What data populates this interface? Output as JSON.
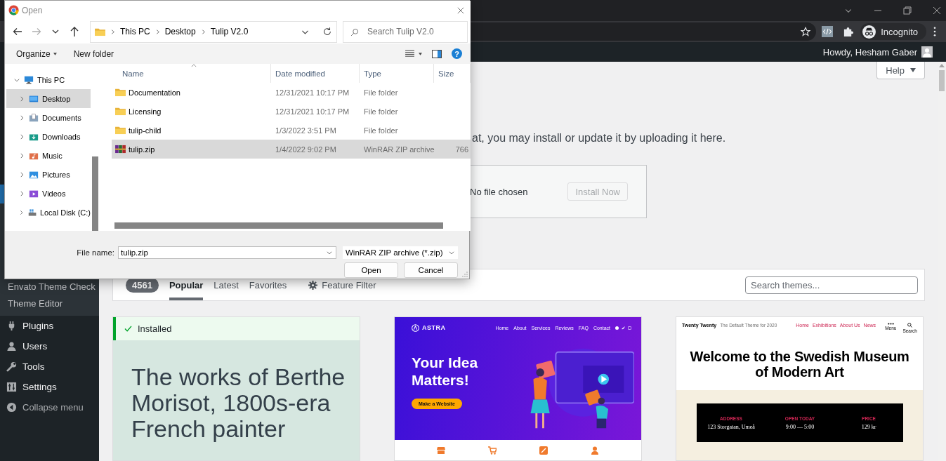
{
  "browser": {
    "profile_label": "Incognito"
  },
  "admin_bar": {
    "greeting": "Howdy, Hesham Gaber"
  },
  "sidebar": {
    "submenu": [
      {
        "label": "Envato Theme Check"
      },
      {
        "label": "Theme Editor"
      }
    ],
    "menu": [
      {
        "label": "Plugins"
      },
      {
        "label": "Users"
      },
      {
        "label": "Tools"
      },
      {
        "label": "Settings"
      },
      {
        "label": "Collapse menu"
      }
    ]
  },
  "help_button": {
    "label": "Help"
  },
  "upload": {
    "intro": "at, you may install or update it by uploading it here.",
    "file_status": "No file chosen",
    "install_button": {
      "label": "Install Now",
      "disabled": true
    }
  },
  "themes_bar": {
    "count": "4561",
    "tabs": [
      {
        "label": "Popular",
        "selected": true
      },
      {
        "label": "Latest",
        "selected": false
      },
      {
        "label": "Favorites",
        "selected": false
      }
    ],
    "feature_filter": "Feature Filter",
    "search": {
      "placeholder": "Search themes..."
    }
  },
  "theme_cards": [
    {
      "kind": "installed",
      "status": "Installed",
      "preview_text": "The works of Berthe Morisot, 1800s-era French painter"
    },
    {
      "kind": "astra",
      "logo": "ASTRA",
      "nav": [
        "Home",
        "About",
        "Services",
        "Reviews",
        "FAQ",
        "Contact"
      ],
      "headline": "Your Idea Matters!",
      "cta": "Make a Website"
    },
    {
      "kind": "twentytwenty",
      "site_title": "Twenty Twenty",
      "tagline": "The Default Theme for 2020",
      "nav": [
        "Home",
        "Exhibitions",
        "About Us",
        "News"
      ],
      "menu_label": "Menu",
      "search_label": "Search",
      "headline": "Welcome to the Swedish Museum of Modern Art",
      "info": [
        {
          "label": "ADDRESS",
          "value": "123 Storgatan, Umeå"
        },
        {
          "label": "OPEN TODAY",
          "value": "9:00 — 5:00"
        },
        {
          "label": "PRICE",
          "value": "129 kr"
        }
      ]
    }
  ],
  "dialog": {
    "title": "Open",
    "nav_buttons": [
      {
        "kind": "back",
        "disabled": false
      },
      {
        "kind": "forward",
        "disabled": true
      },
      {
        "kind": "recent",
        "disabled": false
      },
      {
        "kind": "up",
        "disabled": false
      }
    ],
    "breadcrumbs": [
      "This PC",
      "Desktop",
      "Tulip V2.0"
    ],
    "search": {
      "placeholder": "Search Tulip V2.0"
    },
    "toolbar": {
      "organize": "Organize",
      "new_folder": "New folder",
      "help": "?"
    },
    "nav_tree": [
      {
        "label": "This PC",
        "kind": "computer",
        "selected": false,
        "expanded": true,
        "children": [
          {
            "label": "Desktop",
            "kind": "desktop",
            "selected": true,
            "expanded": false
          },
          {
            "label": "Documents",
            "kind": "documents",
            "selected": false,
            "expanded": false
          },
          {
            "label": "Downloads",
            "kind": "downloads",
            "selected": false,
            "expanded": false
          },
          {
            "label": "Music",
            "kind": "music",
            "selected": false,
            "expanded": false
          },
          {
            "label": "Pictures",
            "kind": "pictures",
            "selected": false,
            "expanded": false
          },
          {
            "label": "Videos",
            "kind": "videos",
            "selected": false,
            "expanded": false
          },
          {
            "label": "Local Disk (C:)",
            "kind": "drive",
            "selected": false,
            "expanded": false
          }
        ]
      }
    ],
    "columns": [
      "Name",
      "Date modified",
      "Type",
      "Size"
    ],
    "files": [
      {
        "kind": "folder",
        "name": "Documentation",
        "date": "12/31/2021 10:17 PM",
        "type": "File folder",
        "selected": false
      },
      {
        "kind": "folder",
        "name": "Licensing",
        "date": "12/31/2021 10:17 PM",
        "type": "File folder",
        "selected": false
      },
      {
        "kind": "folder",
        "name": "tulip-child",
        "date": "1/3/2022 3:51 PM",
        "type": "File folder",
        "selected": false
      },
      {
        "kind": "archive",
        "name": "tulip.zip",
        "date": "1/4/2022 9:02 PM",
        "type": "WinRAR ZIP archive",
        "size": "766",
        "selected": true
      }
    ],
    "file_name": {
      "label": "File name:",
      "value": "tulip.zip"
    },
    "file_type": "WinRAR ZIP archive (*.zip)",
    "buttons": [
      {
        "label": "Open"
      },
      {
        "label": "Cancel"
      }
    ]
  }
}
